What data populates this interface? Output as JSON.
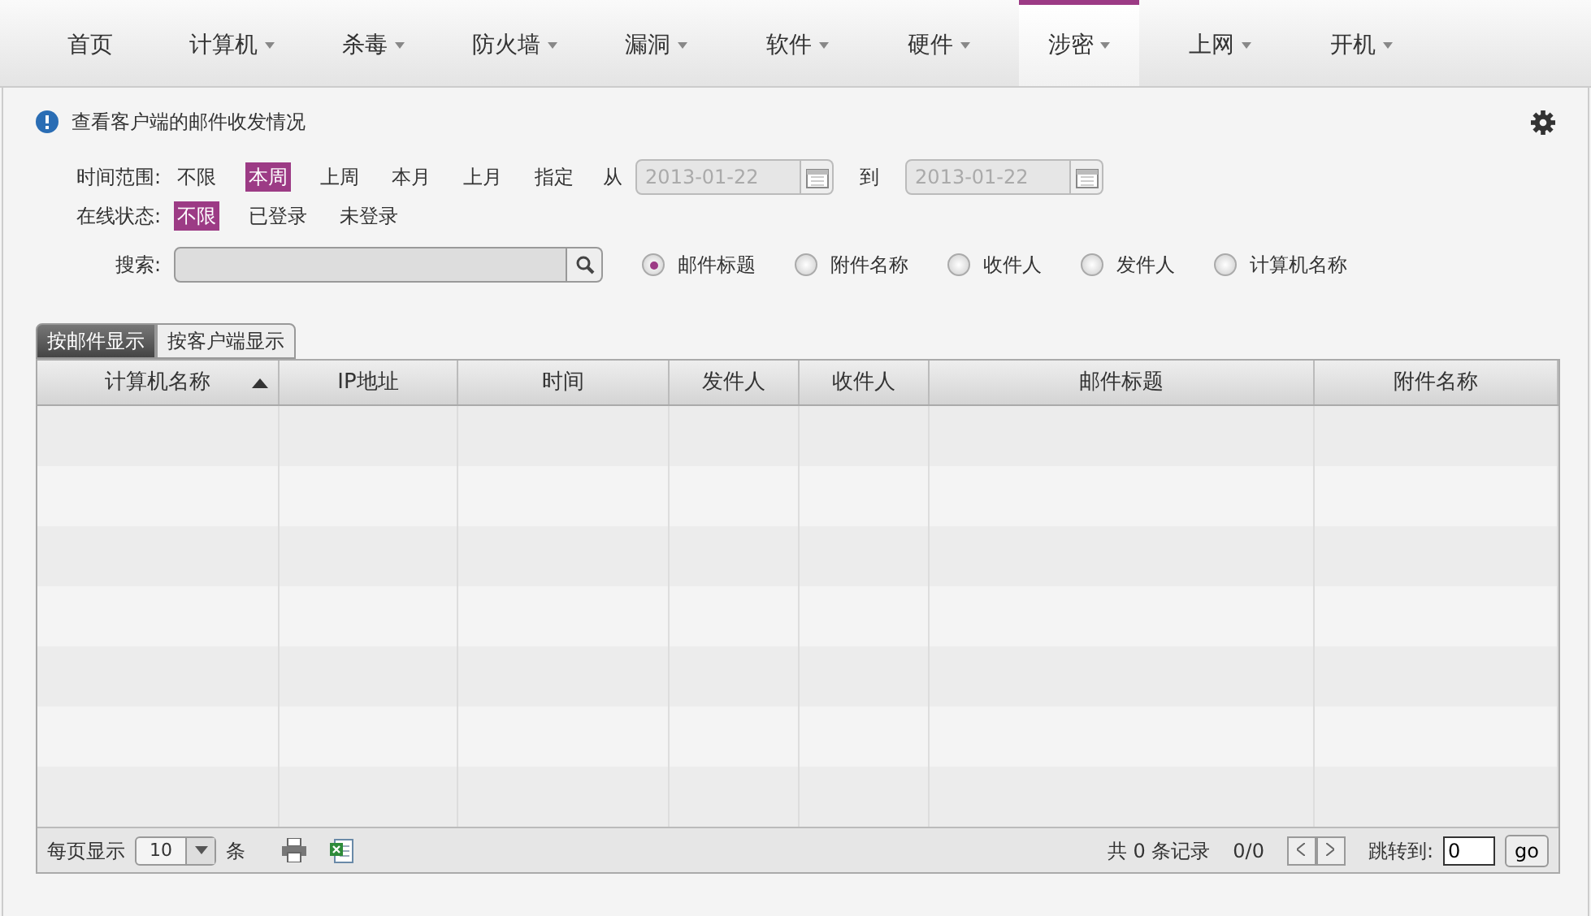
{
  "nav": [
    {
      "label": "首页",
      "dropdown": false,
      "selected": false
    },
    {
      "label": "计算机",
      "dropdown": true,
      "selected": false
    },
    {
      "label": "杀毒",
      "dropdown": true,
      "selected": false
    },
    {
      "label": "防火墙",
      "dropdown": true,
      "selected": false
    },
    {
      "label": "漏洞",
      "dropdown": true,
      "selected": false
    },
    {
      "label": "软件",
      "dropdown": true,
      "selected": false
    },
    {
      "label": "硬件",
      "dropdown": true,
      "selected": false
    },
    {
      "label": "涉密",
      "dropdown": true,
      "selected": true
    },
    {
      "label": "上网",
      "dropdown": true,
      "selected": false
    },
    {
      "label": "开机",
      "dropdown": true,
      "selected": false
    }
  ],
  "info": "查看客户端的邮件收发情况",
  "time_range": {
    "label": "时间范围:",
    "options": [
      {
        "label": "不限",
        "selected": false
      },
      {
        "label": "本周",
        "selected": true
      },
      {
        "label": "上周",
        "selected": false
      },
      {
        "label": "本月",
        "selected": false
      },
      {
        "label": "上月",
        "selected": false
      },
      {
        "label": "指定",
        "selected": false
      }
    ],
    "from_label": "从",
    "from_value": "2013-01-22",
    "to_label": "到",
    "to_value": "2013-01-22"
  },
  "online_status": {
    "label": "在线状态:",
    "options": [
      {
        "label": "不限",
        "selected": true
      },
      {
        "label": "已登录",
        "selected": false
      },
      {
        "label": "未登录",
        "selected": false
      }
    ]
  },
  "search": {
    "label": "搜索:",
    "fields": [
      {
        "label": "邮件标题",
        "selected": true
      },
      {
        "label": "附件名称",
        "selected": false
      },
      {
        "label": "收件人",
        "selected": false
      },
      {
        "label": "发件人",
        "selected": false
      },
      {
        "label": "计算机名称",
        "selected": false
      }
    ]
  },
  "view_tabs": [
    {
      "label": "按邮件显示",
      "selected": true
    },
    {
      "label": "按客户端显示",
      "selected": false
    }
  ],
  "table": {
    "columns": [
      {
        "label": "计算机名称",
        "sorted": true
      },
      {
        "label": "IP地址",
        "sorted": false
      },
      {
        "label": "时间",
        "sorted": false
      },
      {
        "label": "发件人",
        "sorted": false
      },
      {
        "label": "收件人",
        "sorted": false
      },
      {
        "label": "邮件标题",
        "sorted": false
      },
      {
        "label": "附件名称",
        "sorted": false
      }
    ]
  },
  "footer": {
    "per_page_label": "每页显示",
    "per_page": "10",
    "per_page_unit": "条",
    "total": "共 0 条记录",
    "pages": "0/0",
    "jump_label": "跳转到:",
    "jump_value": "0",
    "go": "go"
  }
}
